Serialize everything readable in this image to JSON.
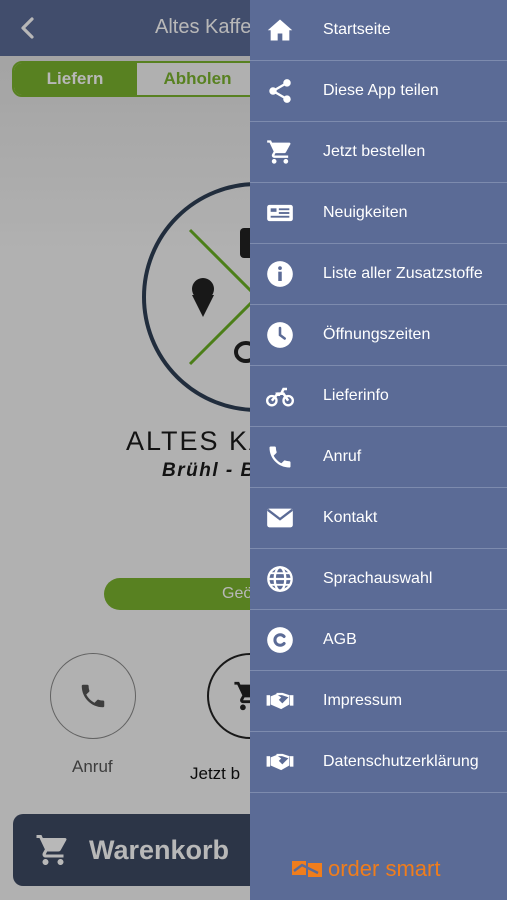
{
  "header": {
    "title": "Altes Kaffe",
    "back_icon": "chevron-left-icon"
  },
  "order_mode": {
    "options": [
      "Liefern",
      "Abholen"
    ],
    "selected": "Liefern"
  },
  "logo": {
    "name": "ALTES KA",
    "subtitle": "Brühl - B"
  },
  "open_status": "Geö",
  "actions": [
    {
      "label": "Anruf",
      "icon": "phone-icon"
    },
    {
      "label": "Jetzt b",
      "icon": "cart-icon"
    }
  ],
  "cart": {
    "label": "Warenkorb",
    "icon": "cart-icon"
  },
  "menu": {
    "items": [
      {
        "label": "Startseite",
        "icon": "home-icon"
      },
      {
        "label": "Diese App teilen",
        "icon": "share-icon"
      },
      {
        "label": "Jetzt bestellen",
        "icon": "cart-icon"
      },
      {
        "label": "Neuigkeiten",
        "icon": "newspaper-icon"
      },
      {
        "label": "Liste aller Zusatzstoffe",
        "icon": "info-icon"
      },
      {
        "label": "Öffnungszeiten",
        "icon": "clock-icon"
      },
      {
        "label": "Lieferinfo",
        "icon": "motorcycle-icon"
      },
      {
        "label": "Anruf",
        "icon": "phone-icon"
      },
      {
        "label": "Kontakt",
        "icon": "envelope-icon"
      },
      {
        "label": "Sprachauswahl",
        "icon": "globe-icon"
      },
      {
        "label": "AGB",
        "icon": "copyright-icon"
      },
      {
        "label": "Impressum",
        "icon": "handshake-icon"
      },
      {
        "label": "Datenschutzerklärung",
        "icon": "handshake-icon"
      }
    ],
    "footer_brand": "order smart"
  },
  "colors": {
    "header": "#5b6b96",
    "accent_green": "#7ab32e",
    "cart_bar": "#3e4a63",
    "brand_orange": "#f07d1c"
  }
}
